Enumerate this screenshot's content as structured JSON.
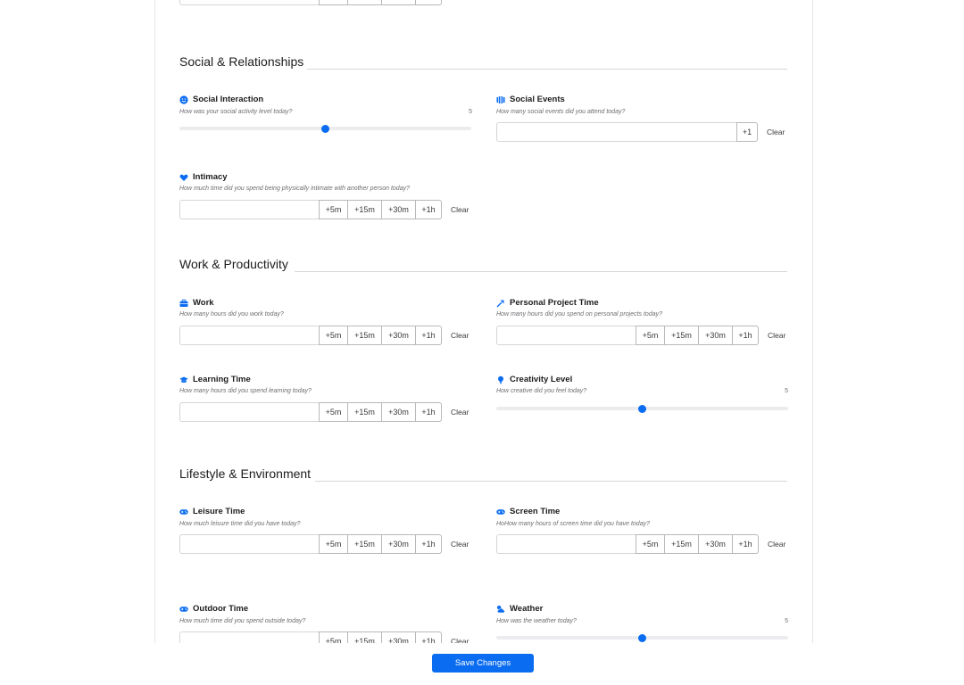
{
  "sections": {
    "social": "Social & Relationships",
    "work": "Work & Productivity",
    "lifestyle": "Lifestyle & Environment"
  },
  "time_buttons": [
    "+5m",
    "+15m",
    "+30m",
    "+1h"
  ],
  "clear_label": "Clear",
  "fields": {
    "social_interaction": {
      "title": "Social Interaction",
      "subtitle": "How was your social activity level today?",
      "value": "5",
      "level_fraction": 0.5,
      "icon": "smiley-icon"
    },
    "social_events": {
      "title": "Social Events",
      "subtitle": "How many social events did you attend today?",
      "button": "+1",
      "icon": "people-icon"
    },
    "intimacy": {
      "title": "Intimacy",
      "subtitle": "How much time did you spend being physically intimate with another person today?",
      "icon": "heart-icon"
    },
    "work": {
      "title": "Work",
      "subtitle": "How many hours did you work today?",
      "icon": "briefcase-icon"
    },
    "personal_project": {
      "title": "Personal Project Time",
      "subtitle": "How many hours did you spend on personal projects today?",
      "icon": "hammer-icon"
    },
    "learning": {
      "title": "Learning Time",
      "subtitle": "How many hours did you spend learning today?",
      "icon": "graduation-cap-icon"
    },
    "creativity": {
      "title": "Creativity Level",
      "subtitle": "How creative did you feel today?",
      "value": "5",
      "level_fraction": 0.5,
      "icon": "lightbulb-icon"
    },
    "leisure": {
      "title": "Leisure Time",
      "subtitle": "How much leisure time did you have today?",
      "icon": "gamepad-icon"
    },
    "screen": {
      "title": "Screen Time",
      "subtitle": "HoHow many hours of screen time did you have today?",
      "icon": "gamepad-icon"
    },
    "outdoor": {
      "title": "Outdoor Time",
      "subtitle": "How much time did you spend outside today?",
      "icon": "gamepad-icon"
    },
    "weather": {
      "title": "Weather",
      "subtitle": "How was the weather today?",
      "value": "5",
      "level_fraction": 0.5,
      "icon": "cloud-sun-icon"
    }
  },
  "save_label": "Save Changes",
  "colors": {
    "accent": "#0a6cf0",
    "border": "#d6d6da",
    "muted": "#6e6e73"
  }
}
